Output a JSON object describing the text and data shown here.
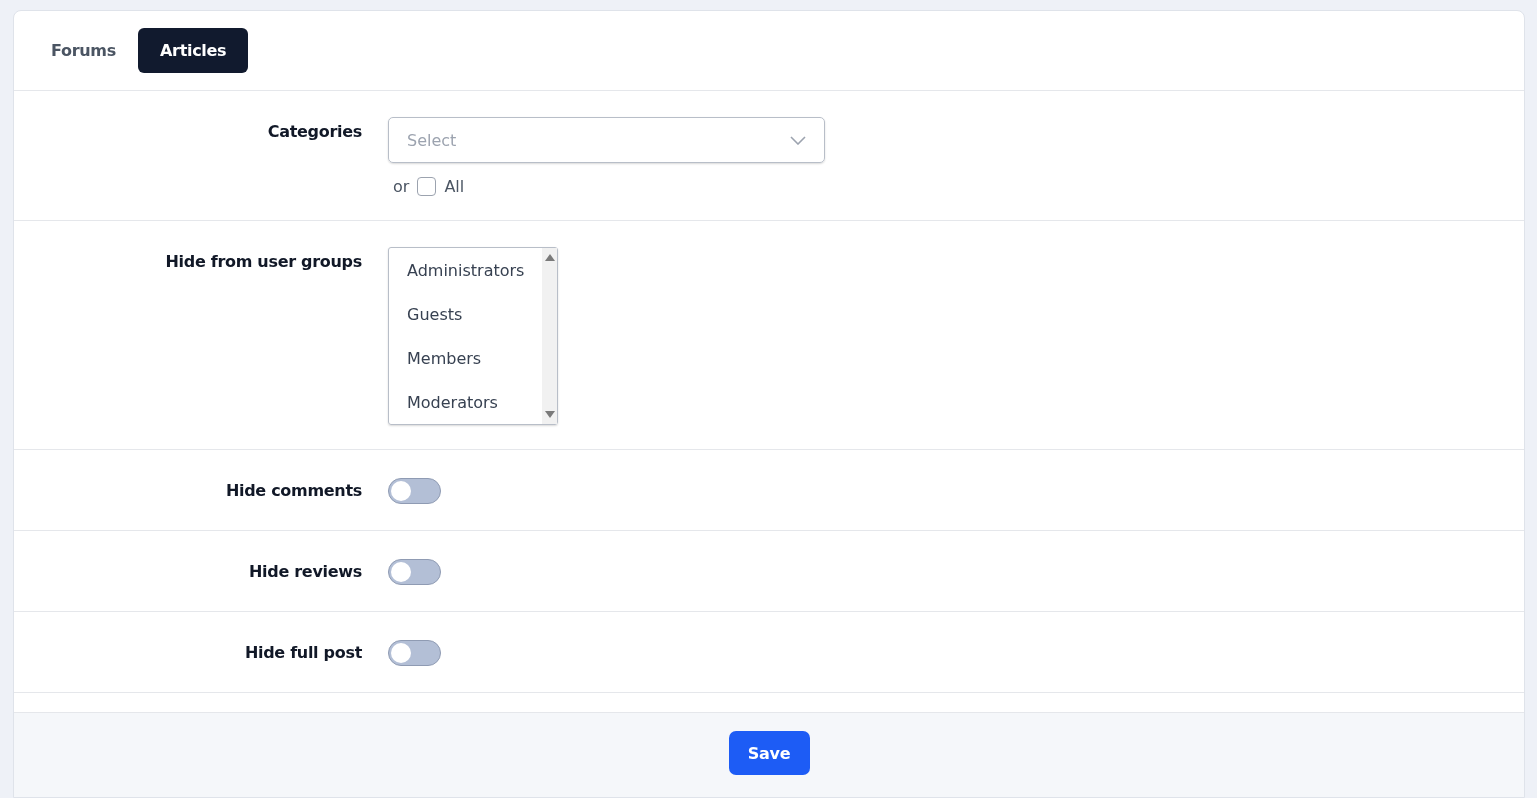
{
  "tabs": [
    {
      "label": "Forums",
      "selected": false
    },
    {
      "label": "Articles",
      "selected": true
    }
  ],
  "categories": {
    "label": "Categories",
    "placeholder": "Select",
    "or_text": "or",
    "all_label": "All",
    "all_checked": false
  },
  "user_groups": {
    "label": "Hide from user groups",
    "options": [
      {
        "label": "Administrators",
        "selected": false
      },
      {
        "label": "Guests",
        "selected": false
      },
      {
        "label": "Members",
        "selected": false
      },
      {
        "label": "Moderators",
        "selected": false
      }
    ]
  },
  "toggles": [
    {
      "label": "Hide comments",
      "on": false
    },
    {
      "label": "Hide reviews",
      "on": false
    },
    {
      "label": "Hide full post",
      "on": false
    }
  ],
  "save_button": "Save"
}
